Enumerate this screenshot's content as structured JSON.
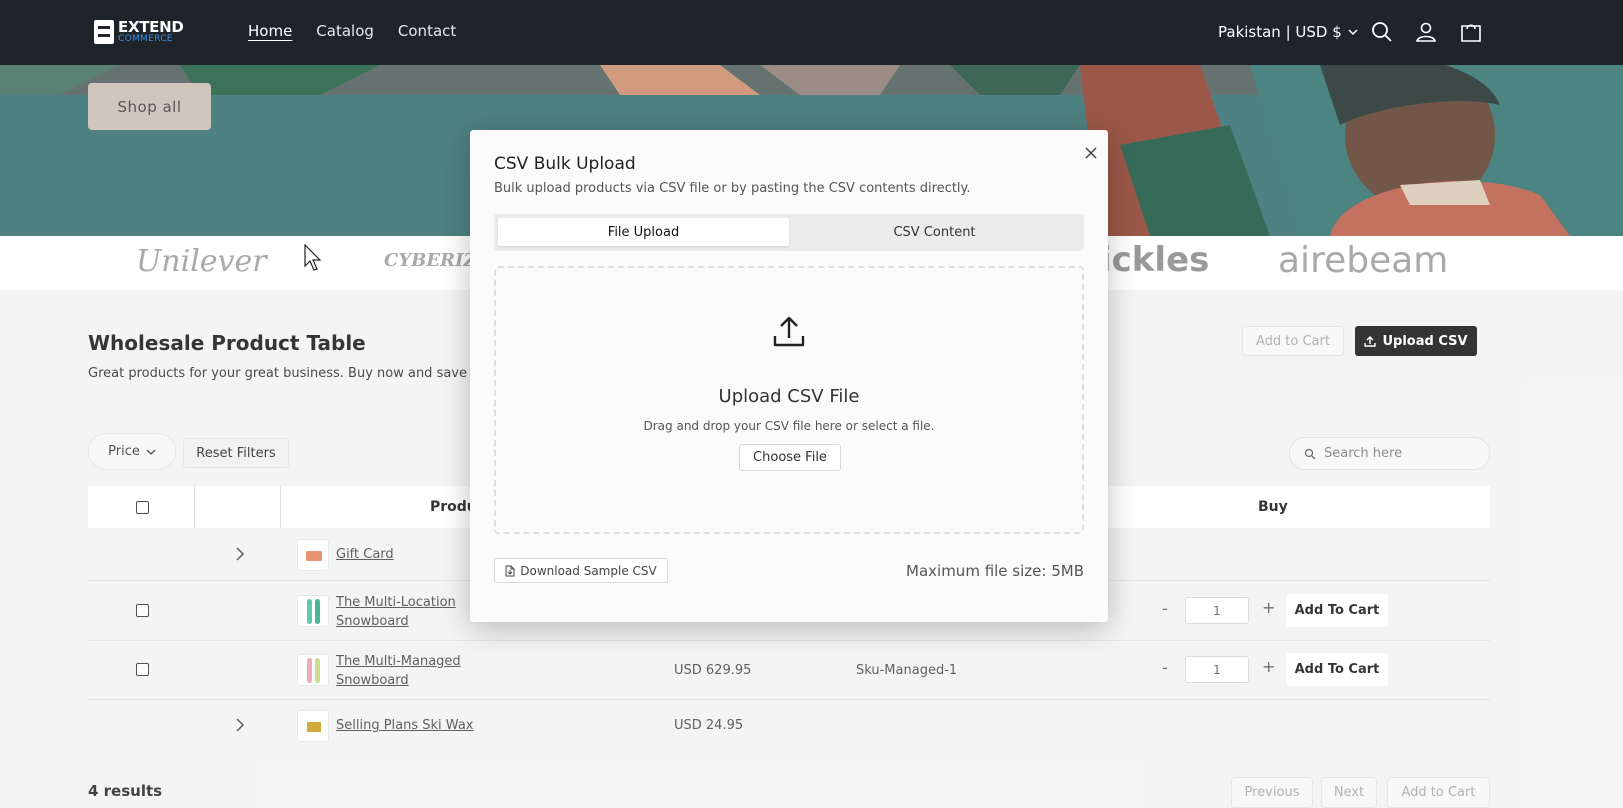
{
  "header": {
    "logo_line1": "EXTEND",
    "logo_line2": "COMMERCE",
    "nav": [
      {
        "label": "Home"
      },
      {
        "label": "Catalog"
      },
      {
        "label": "Contact"
      }
    ],
    "locale": "Pakistan | USD $",
    "icons": [
      "search-icon",
      "account-icon",
      "cart-icon"
    ]
  },
  "hero": {
    "shop_all_label": "Shop all"
  },
  "brands": [
    "Unilever",
    "CYBERIZE",
    "ickles",
    "airebeam"
  ],
  "section": {
    "title": "Wholesale Product Table",
    "subtitle": "Great products for your great business. Buy now and save up",
    "add_to_cart_label": "Add to Cart",
    "upload_csv_label": "Upload CSV"
  },
  "filters": {
    "price_label": "Price",
    "reset_label": "Reset Filters",
    "search_placeholder": "Search here"
  },
  "table": {
    "headers": {
      "product": "Produ",
      "buy": "Buy"
    },
    "rows": [
      {
        "name": "Gift Card",
        "price": "",
        "sku": "",
        "qty": ""
      },
      {
        "name_line1": "The Multi-Location",
        "name_line2": "Snowboard",
        "price": "",
        "sku": "",
        "qty": "1",
        "add_label": "Add To Cart"
      },
      {
        "name_line1": "The Multi-Managed",
        "name_line2": "Snowboard",
        "price": "USD 629.95",
        "sku": "Sku-Managed-1",
        "qty": "1",
        "add_label": "Add To Cart"
      },
      {
        "name": "Selling Plans Ski Wax",
        "price": "USD 24.95",
        "sku": "",
        "qty": ""
      }
    ],
    "qty_minus": "-",
    "qty_plus": "+"
  },
  "footer": {
    "results": "4 results",
    "previous": "Previous",
    "next": "Next",
    "add_to_cart": "Add to Cart"
  },
  "modal": {
    "title": "CSV Bulk Upload",
    "subtitle": "Bulk upload products via CSV file or by pasting the CSV contents directly.",
    "tabs": [
      {
        "label": "File Upload",
        "active": true
      },
      {
        "label": "CSV Content",
        "active": false
      }
    ],
    "dropzone_title": "Upload CSV File",
    "dropzone_subtitle": "Drag and drop your CSV file here or select a file.",
    "choose_file_label": "Choose File",
    "download_sample_label": "Download Sample CSV",
    "max_size": "Maximum file size: 5MB"
  },
  "colors": {
    "header_bg": "#1f242b",
    "hero_bg": "#2f6b6b",
    "accent_blue": "#3b8ee0",
    "button_dark": "#111111"
  }
}
